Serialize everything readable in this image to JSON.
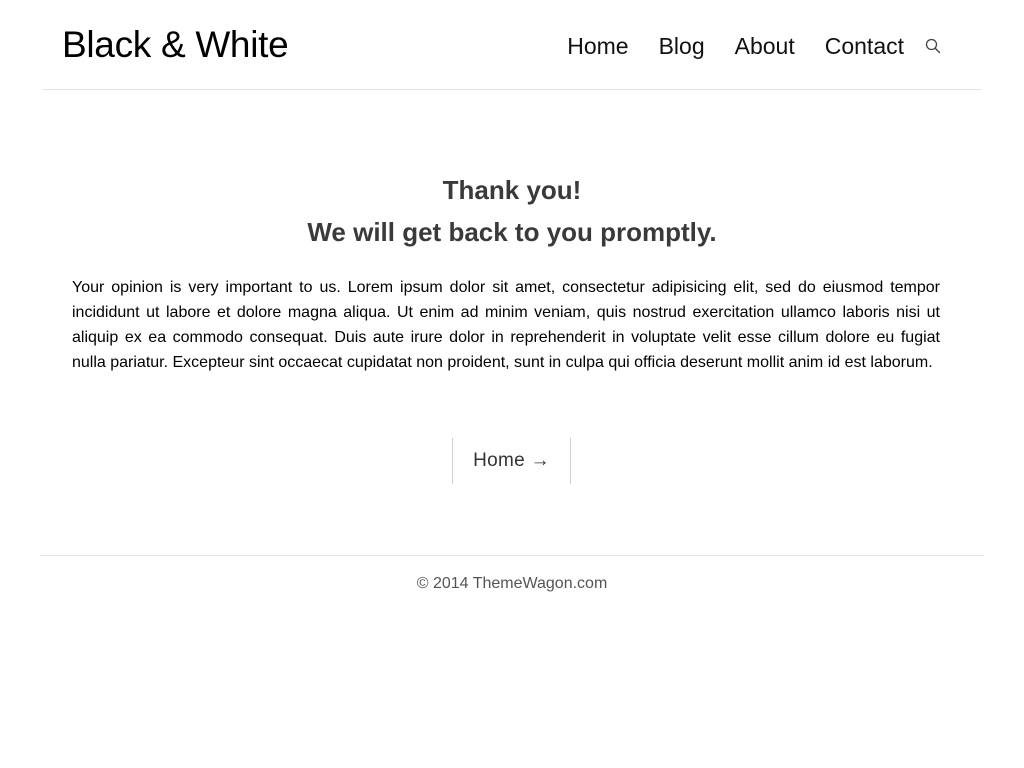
{
  "header": {
    "logo": "Black & White",
    "nav": [
      {
        "label": "Home"
      },
      {
        "label": "Blog"
      },
      {
        "label": "About"
      },
      {
        "label": "Contact"
      }
    ],
    "search_icon": "search-icon"
  },
  "main": {
    "heading_line1": "Thank you!",
    "heading_line2": "We will get back to you promptly.",
    "paragraph": "Your opinion is very important to us. Lorem ipsum dolor sit amet, consectetur adipisicing elit, sed do eiusmod tempor incididunt ut labore et dolore magna aliqua. Ut enim ad minim veniam, quis nostrud exercitation ullamco laboris nisi ut aliquip ex ea commodo consequat. Duis aute irure dolor in reprehenderit in voluptate velit esse cillum dolore eu fugiat nulla pariatur. Excepteur sint occaecat cupidatat non proident, sunt in culpa qui officia deserunt mollit anim id est laborum.",
    "home_button": "Home →"
  },
  "footer": {
    "copyright": "© 2014 ThemeWagon.com"
  }
}
